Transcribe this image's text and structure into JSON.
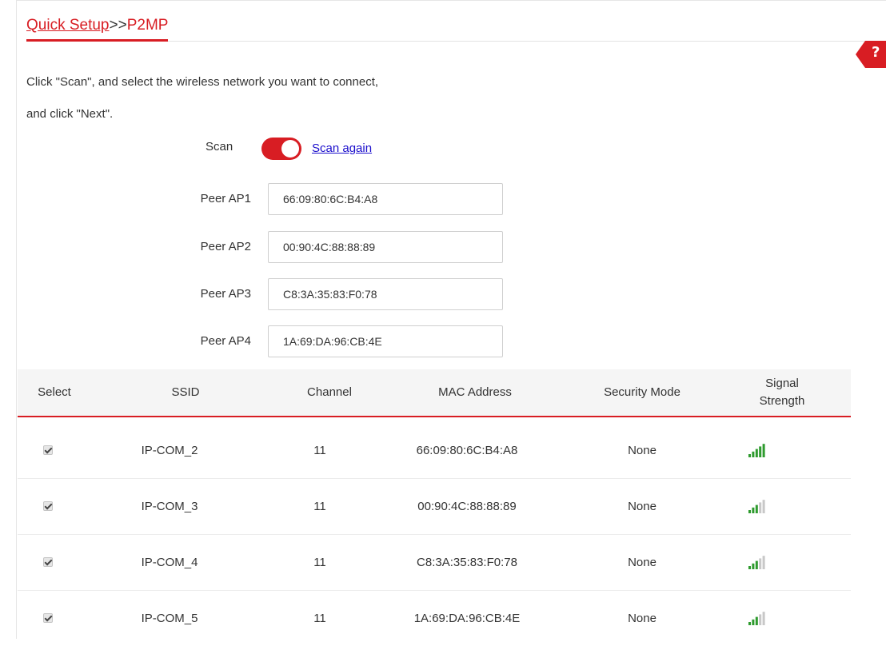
{
  "breadcrumb": {
    "part1": "Quick Setup",
    "separator": ">>",
    "part2": "P2MP"
  },
  "help": {
    "label": "?"
  },
  "intro": {
    "line1": "Click \"Scan\", and select the wireless network you want to connect,",
    "line2": "and click \"Next\"."
  },
  "scan": {
    "label": "Scan",
    "toggle_on": true,
    "again_link": "Scan again"
  },
  "peers": [
    {
      "label": "Peer AP1",
      "value": "66:09:80:6C:B4:A8"
    },
    {
      "label": "Peer AP2",
      "value": "00:90:4C:88:88:89"
    },
    {
      "label": "Peer AP3",
      "value": "C8:3A:35:83:F0:78"
    },
    {
      "label": "Peer AP4",
      "value": "1A:69:DA:96:CB:4E"
    }
  ],
  "table": {
    "headers": {
      "select": "Select",
      "ssid": "SSID",
      "channel": "Channel",
      "mac": "MAC Address",
      "security": "Security Mode",
      "signal_line1": "Signal",
      "signal_line2": "Strength"
    },
    "rows": [
      {
        "selected": true,
        "ssid": "IP-COM_2",
        "channel": "11",
        "mac": "66:09:80:6C:B4:A8",
        "security": "None",
        "signal_bars": 5
      },
      {
        "selected": true,
        "ssid": "IP-COM_3",
        "channel": "11",
        "mac": "00:90:4C:88:88:89",
        "security": "None",
        "signal_bars": 3
      },
      {
        "selected": true,
        "ssid": "IP-COM_4",
        "channel": "11",
        "mac": "C8:3A:35:83:F0:78",
        "security": "None",
        "signal_bars": 3
      },
      {
        "selected": true,
        "ssid": "IP-COM_5",
        "channel": "11",
        "mac": "1A:69:DA:96:CB:4E",
        "security": "None",
        "signal_bars": 3
      }
    ]
  },
  "colors": {
    "accent": "#d81d23",
    "link": "#1a0dcc",
    "signal_on": "#2e9b2e",
    "signal_off": "#c8c8c8"
  }
}
